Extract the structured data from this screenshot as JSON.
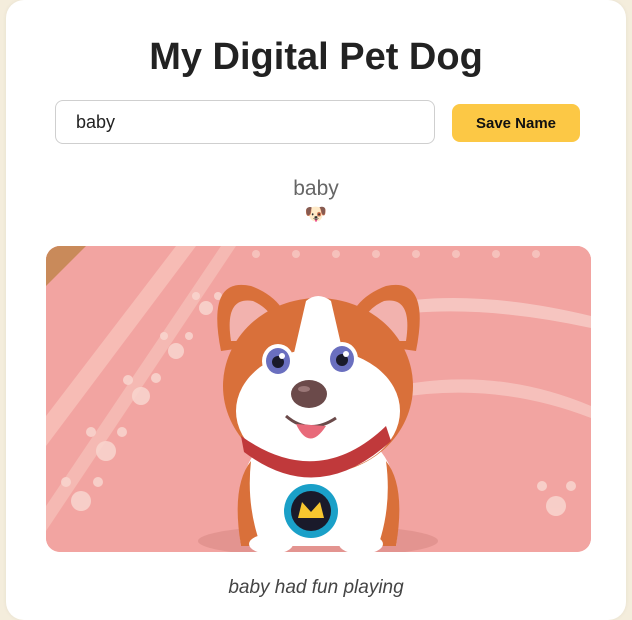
{
  "app": {
    "title": "My Digital Pet Dog"
  },
  "name_form": {
    "input_value": "baby",
    "save_label": "Save Name"
  },
  "pet": {
    "name": "baby",
    "emoji": "🐶",
    "image_description_icon": "corgi-image",
    "status": "baby had fun playing"
  },
  "colors": {
    "accent": "#fcc845",
    "page_background": "#f4eddc",
    "card_background": "#ffffff"
  }
}
